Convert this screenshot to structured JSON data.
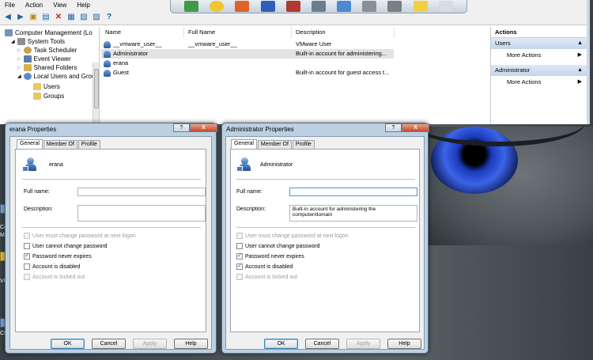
{
  "menu": [
    "File",
    "Action",
    "View",
    "Help"
  ],
  "tree": [
    {
      "label": "Computer Management (Lo",
      "indent": 0
    },
    {
      "label": "System Tools",
      "indent": 1
    },
    {
      "label": "Task Scheduler",
      "indent": 2
    },
    {
      "label": "Event Viewer",
      "indent": 2
    },
    {
      "label": "Shared Folders",
      "indent": 2
    },
    {
      "label": "Local Users and Grou",
      "indent": 2
    },
    {
      "label": "Users",
      "indent": 3
    },
    {
      "label": "Groups",
      "indent": 3
    }
  ],
  "list": {
    "columns": [
      "Name",
      "Full Name",
      "Description"
    ],
    "rows": [
      {
        "name": "__vmware_user__",
        "fullname": "__vmware_user__",
        "desc": "VMware User"
      },
      {
        "name": "Administrator",
        "fullname": "",
        "desc": "Built-in account for administering..."
      },
      {
        "name": "erana",
        "fullname": "",
        "desc": ""
      },
      {
        "name": "Guest",
        "fullname": "",
        "desc": "Built-in account for guest access t..."
      }
    ]
  },
  "actions": {
    "header": "Actions",
    "sections": [
      {
        "title": "Users",
        "item": "More Actions"
      },
      {
        "title": "Administrator",
        "item": "More Actions"
      }
    ]
  },
  "dialog_erana": {
    "title": "erana Properties",
    "help": "?",
    "close": "X",
    "tabs": [
      "General",
      "Member Of",
      "Profile"
    ],
    "username": "erana",
    "fullname_label": "Full name:",
    "fullname_value": "",
    "description_label": "Description:",
    "description_value": "",
    "checks": [
      {
        "label": "User must change password at next logon",
        "checked": false,
        "disabled": true
      },
      {
        "label": "User cannot change password",
        "checked": false,
        "disabled": false
      },
      {
        "label": "Password never expires",
        "checked": true,
        "disabled": false
      },
      {
        "label": "Account is disabled",
        "checked": false,
        "disabled": false
      },
      {
        "label": "Account is locked out",
        "checked": false,
        "disabled": true
      }
    ],
    "buttons": [
      "OK",
      "Cancel",
      "Apply",
      "Help"
    ]
  },
  "dialog_admin": {
    "title": "Administrator Properties",
    "help": "?",
    "close": "X",
    "tabs": [
      "General",
      "Member Of",
      "Profile"
    ],
    "username": "Administrator",
    "fullname_label": "Full name:",
    "fullname_value": "",
    "description_label": "Description:",
    "description_value": "Built-in account for administering the computer/domain",
    "checks": [
      {
        "label": "User must change password at next logon",
        "checked": false,
        "disabled": true
      },
      {
        "label": "User cannot change password",
        "checked": false,
        "disabled": false
      },
      {
        "label": "Password never expires",
        "checked": true,
        "disabled": false
      },
      {
        "label": "Account is disabled",
        "checked": true,
        "disabled": false
      },
      {
        "label": "Account is locked out",
        "checked": false,
        "disabled": true
      }
    ],
    "buttons": [
      "OK",
      "Cancel",
      "Apply",
      "Help"
    ]
  },
  "desktop_labels": [
    "Co",
    "Ma",
    "VG",
    "CE"
  ]
}
